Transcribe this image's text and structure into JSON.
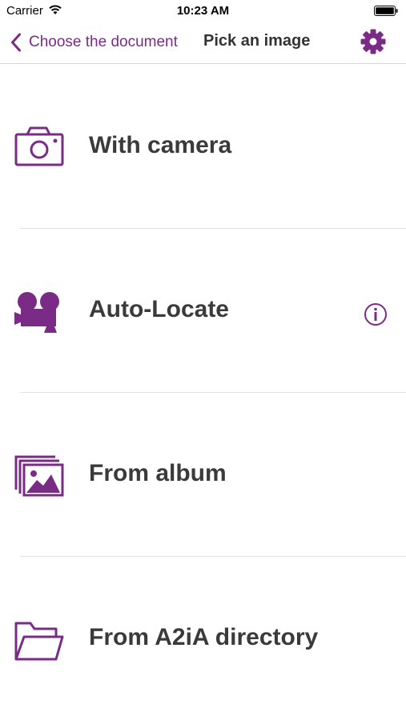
{
  "status_bar": {
    "carrier": "Carrier",
    "time": "10:23 AM",
    "wifi_icon": "wifi-icon",
    "battery_icon": "battery-icon"
  },
  "nav": {
    "back_label": "Choose the document",
    "title": "Pick an image",
    "back_icon": "chevron-left-icon",
    "settings_icon": "gear-icon"
  },
  "menu": {
    "items": [
      {
        "label": "With camera",
        "icon": "camera-icon"
      },
      {
        "label": "Auto-Locate",
        "icon": "video-camera-icon",
        "accessory_icon": "info-icon"
      },
      {
        "label": "From album",
        "icon": "photo-album-icon"
      },
      {
        "label": "From A2iA directory",
        "icon": "folder-icon"
      }
    ]
  },
  "colors": {
    "accent": "#7a2b86",
    "text": "#3a3a3c",
    "divider": "#e1e1e1",
    "background": "#ffffff"
  }
}
